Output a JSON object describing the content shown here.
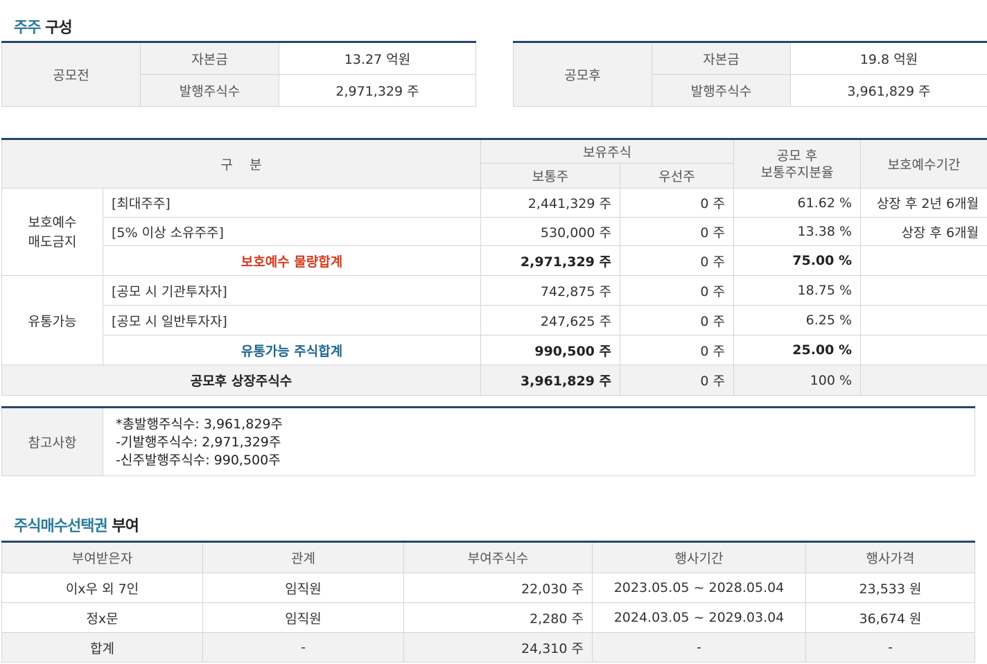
{
  "shareholders_section": {
    "title_highlight": "주주",
    "title_rest": " 구성"
  },
  "before_offering": {
    "label": "공모전",
    "capital_label": "자본금",
    "capital_value": "13.27 억원",
    "shares_label": "발행주식수",
    "shares_value": "2,971,329 주"
  },
  "after_offering": {
    "label": "공모후",
    "capital_label": "자본금",
    "capital_value": "19.8 억원",
    "shares_label": "발행주식수",
    "shares_value": "3,961,829 주"
  },
  "holding_table": {
    "headers": {
      "category": "구    분",
      "holding": "보유주식",
      "common": "보통주",
      "preferred": "우선주",
      "ratio": "공모 후\n보통주지분율",
      "lockup": "보호예수기간"
    },
    "group1": {
      "label_line1": "보호예수",
      "label_line2": "매도금지"
    },
    "group2": {
      "label": "유통가능"
    },
    "rows": [
      {
        "name": "[최대주주]",
        "common": "2,441,329 주",
        "preferred": "0 주",
        "ratio": "61.62 %",
        "lockup": "상장 후 2년 6개월"
      },
      {
        "name": "[5% 이상 소유주주]",
        "common": "530,000 주",
        "preferred": "0 주",
        "ratio": "13.38 %",
        "lockup": "상장 후 6개월"
      },
      {
        "name": "보호예수 물량합계",
        "common": "2,971,329 주",
        "preferred": "0 주",
        "ratio": "75.00 %",
        "lockup": ""
      },
      {
        "name": "[공모 시 기관투자자]",
        "common": "742,875 주",
        "preferred": "0 주",
        "ratio": "18.75 %",
        "lockup": ""
      },
      {
        "name": "[공모 시 일반투자자]",
        "common": "247,625 주",
        "preferred": "0 주",
        "ratio": "6.25 %",
        "lockup": ""
      },
      {
        "name": "유통가능 주식합계",
        "common": "990,500 주",
        "preferred": "0 주",
        "ratio": "25.00 %",
        "lockup": ""
      }
    ],
    "total": {
      "name": "공모후 상장주식수",
      "common": "3,961,829 주",
      "preferred": "0 주",
      "ratio": "100 %",
      "lockup": ""
    }
  },
  "notes": {
    "label": "참고사항",
    "lines": [
      "*총발행주식수: 3,961,829주",
      "-기발행주식수: 2,971,329주",
      "-신주발행주식수: 990,500주"
    ]
  },
  "options_section": {
    "title_highlight": "주식매수선택권",
    "title_rest": " 부여"
  },
  "options_table": {
    "headers": [
      "부여받은자",
      "관계",
      "부여주식수",
      "행사기간",
      "행사가격"
    ],
    "rows": [
      [
        "이x우 외 7인",
        "임직원",
        "22,030 주",
        "2023.05.05 ~ 2028.05.04",
        "23,533 원"
      ],
      [
        "정x문",
        "임직원",
        "2,280 주",
        "2024.03.05 ~ 2029.03.04",
        "36,674 원"
      ]
    ],
    "total": [
      "합계",
      "-",
      "24,310 주",
      "-",
      "-"
    ]
  }
}
